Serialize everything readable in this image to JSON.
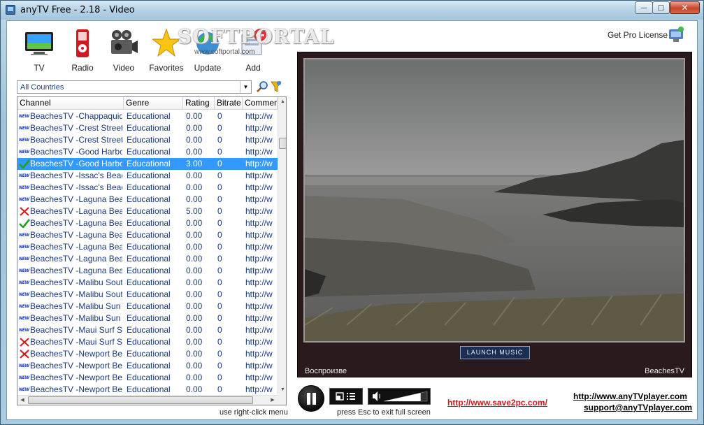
{
  "window": {
    "title": "anyTV Free - 2.18 - Video",
    "minimize_glyph": "—",
    "maximize_glyph": "□",
    "close_glyph": "✕"
  },
  "toolbar": {
    "items": [
      {
        "label": "TV",
        "icon": "tv-icon"
      },
      {
        "label": "Radio",
        "icon": "radio-icon"
      },
      {
        "label": "Video",
        "icon": "video-camera-icon"
      },
      {
        "label": "Favorites",
        "icon": "star-icon"
      },
      {
        "label": "Update",
        "icon": "update-icon"
      },
      {
        "label": "Add",
        "icon": "add-icon"
      }
    ],
    "watermark": "SOFTPORTAL",
    "watermark_sub": "www.softportal.com",
    "get_pro_label": "Get Pro License"
  },
  "filter": {
    "country_value": "All Countries"
  },
  "table": {
    "columns": [
      "Channel",
      "Genre",
      "Rating",
      "Bitrate",
      "Comment"
    ],
    "rows": [
      {
        "status": "new",
        "name": "BeachesTV -Chappaquid...",
        "genre": "Educational",
        "rating": "0.00",
        "bitrate": "0",
        "comment": "http://w"
      },
      {
        "status": "new",
        "name": "BeachesTV -Crest Street...",
        "genre": "Educational",
        "rating": "0.00",
        "bitrate": "0",
        "comment": "http://w"
      },
      {
        "status": "new",
        "name": "BeachesTV -Crest Street...",
        "genre": "Educational",
        "rating": "0.00",
        "bitrate": "0",
        "comment": "http://w"
      },
      {
        "status": "new",
        "name": "BeachesTV -Good Harbo...",
        "genre": "Educational",
        "rating": "0.00",
        "bitrate": "0",
        "comment": "http://w"
      },
      {
        "status": "ok",
        "name": "BeachesTV -Good Harbo...",
        "genre": "Educational",
        "rating": "3.00",
        "bitrate": "0",
        "comment": "http://w",
        "selected": true
      },
      {
        "status": "new",
        "name": "BeachesTV -Issac's Beac...",
        "genre": "Educational",
        "rating": "0.00",
        "bitrate": "0",
        "comment": "http://w"
      },
      {
        "status": "new",
        "name": "BeachesTV -Issac's Beac...",
        "genre": "Educational",
        "rating": "0.00",
        "bitrate": "0",
        "comment": "http://w"
      },
      {
        "status": "new",
        "name": "BeachesTV -Laguna Bea...",
        "genre": "Educational",
        "rating": "0.00",
        "bitrate": "0",
        "comment": "http://w"
      },
      {
        "status": "fail",
        "name": "BeachesTV -Laguna Bea...",
        "genre": "Educational",
        "rating": "5.00",
        "bitrate": "0",
        "comment": "http://w"
      },
      {
        "status": "ok",
        "name": "BeachesTV -Laguna Bea...",
        "genre": "Educational",
        "rating": "0.00",
        "bitrate": "0",
        "comment": "http://w"
      },
      {
        "status": "new",
        "name": "BeachesTV -Laguna Bea...",
        "genre": "Educational",
        "rating": "0.00",
        "bitrate": "0",
        "comment": "http://w"
      },
      {
        "status": "new",
        "name": "BeachesTV -Laguna Bea...",
        "genre": "Educational",
        "rating": "0.00",
        "bitrate": "0",
        "comment": "http://w"
      },
      {
        "status": "new",
        "name": "BeachesTV -Laguna Bea...",
        "genre": "Educational",
        "rating": "0.00",
        "bitrate": "0",
        "comment": "http://w"
      },
      {
        "status": "new",
        "name": "BeachesTV -Laguna Bea...",
        "genre": "Educational",
        "rating": "0.00",
        "bitrate": "0",
        "comment": "http://w"
      },
      {
        "status": "new",
        "name": "BeachesTV -Malibu Sout...",
        "genre": "Educational",
        "rating": "0.00",
        "bitrate": "0",
        "comment": "http://w"
      },
      {
        "status": "new",
        "name": "BeachesTV -Malibu Sout...",
        "genre": "Educational",
        "rating": "0.00",
        "bitrate": "0",
        "comment": "http://w"
      },
      {
        "status": "new",
        "name": "BeachesTV -Malibu Sun ...",
        "genre": "Educational",
        "rating": "0.00",
        "bitrate": "0",
        "comment": "http://w"
      },
      {
        "status": "new",
        "name": "BeachesTV -Malibu Sun ...",
        "genre": "Educational",
        "rating": "0.00",
        "bitrate": "0",
        "comment": "http://w"
      },
      {
        "status": "new",
        "name": "BeachesTV -Maui Surf S...",
        "genre": "Educational",
        "rating": "0.00",
        "bitrate": "0",
        "comment": "http://w"
      },
      {
        "status": "fail",
        "name": "BeachesTV -Maui Surf S...",
        "genre": "Educational",
        "rating": "0.00",
        "bitrate": "0",
        "comment": "http://w"
      },
      {
        "status": "fail",
        "name": "BeachesTV -Newport Be...",
        "genre": "Educational",
        "rating": "0.00",
        "bitrate": "0",
        "comment": "http://w"
      },
      {
        "status": "new",
        "name": "BeachesTV -Newport Be...",
        "genre": "Educational",
        "rating": "0.00",
        "bitrate": "0",
        "comment": "http://w"
      },
      {
        "status": "new",
        "name": "BeachesTV -Newport Be...",
        "genre": "Educational",
        "rating": "0.00",
        "bitrate": "0",
        "comment": "http://w"
      },
      {
        "status": "new",
        "name": "BeachesTV -Newport Be...",
        "genre": "Educational",
        "rating": "0.00",
        "bitrate": "0",
        "comment": "http://w"
      }
    ],
    "hint": "use right-click menu"
  },
  "video": {
    "launch_label": "LAUNCH MUSIC",
    "status_left": "Воспроизве",
    "status_right": "BeachesTV",
    "colors": {
      "panel": "#2a1a1c",
      "sky": "#8c8c8c",
      "sea": "#6f6f6f"
    }
  },
  "controls": {
    "esc_hint": "press Esc to exit full screen",
    "link_save2pc": "http://www.save2pc.com/",
    "link_anytv": "http://www.anyTVplayer.com",
    "link_support": "support@anyTVplayer.com",
    "volume_level": 0.85
  },
  "colors": {
    "selection": "#3399ff",
    "link_red": "#cc1a1a",
    "row_text": "#1a3a7a"
  }
}
